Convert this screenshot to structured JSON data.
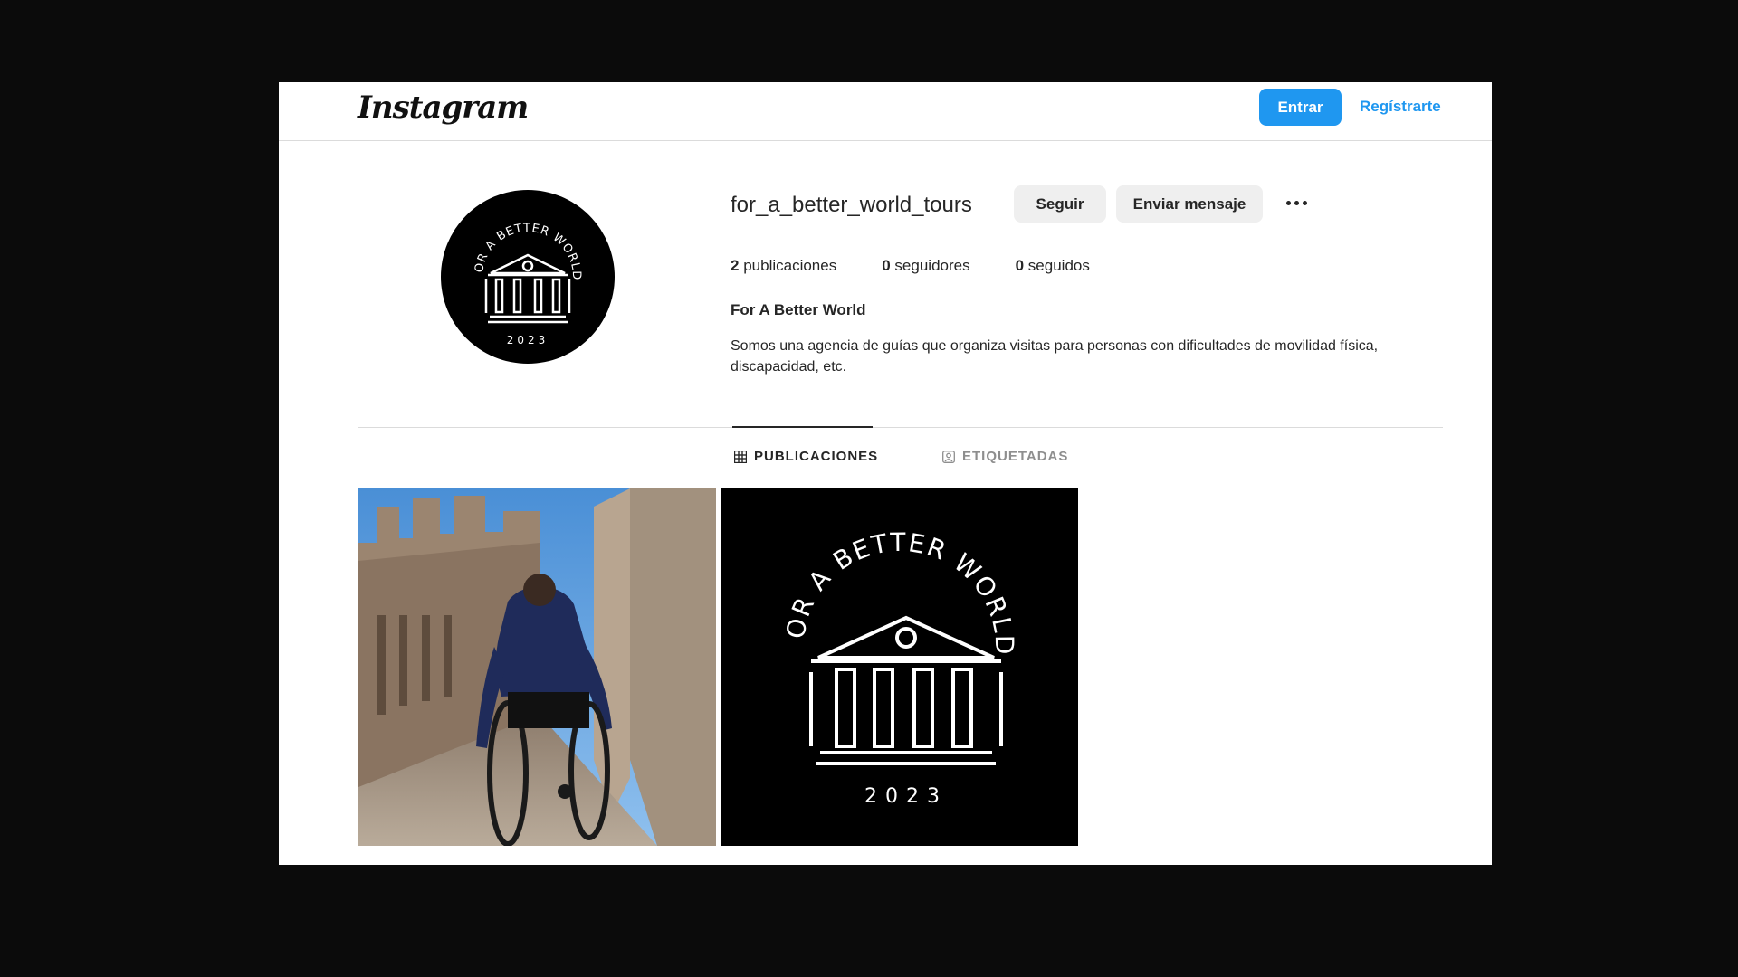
{
  "app": {
    "logo_text": "Instagram"
  },
  "header": {
    "login_label": "Entrar",
    "signup_label": "Regístrarte"
  },
  "profile": {
    "username": "for_a_better_world_tours",
    "follow_label": "Seguir",
    "message_label": "Enviar mensaje",
    "more_icon": "more-options-icon",
    "stats": [
      {
        "count": "2",
        "label": "publicaciones"
      },
      {
        "count": "0",
        "label": "seguidores"
      },
      {
        "count": "0",
        "label": "seguidos"
      }
    ],
    "full_name": "For A Better World",
    "bio": "Somos una agencia de guías que organiza visitas para personas con dificultades de movilidad física, discapacidad, etc.",
    "logo_arc_text": "FOR A BETTER WORLD",
    "logo_year": "2023"
  },
  "tabs": [
    {
      "label": "PUBLICACIONES",
      "icon": "grid-icon",
      "active": true
    },
    {
      "label": "ETIQUETADAS",
      "icon": "tagged-icon",
      "active": false
    }
  ],
  "posts": [
    {
      "type": "photo",
      "icon": "wheelchair-photo"
    },
    {
      "type": "logo",
      "arc_text": "FOR A BETTER WORLD",
      "year": "2023"
    }
  ],
  "colors": {
    "accent": "#1f97f0",
    "background": "#0b0b0b"
  }
}
